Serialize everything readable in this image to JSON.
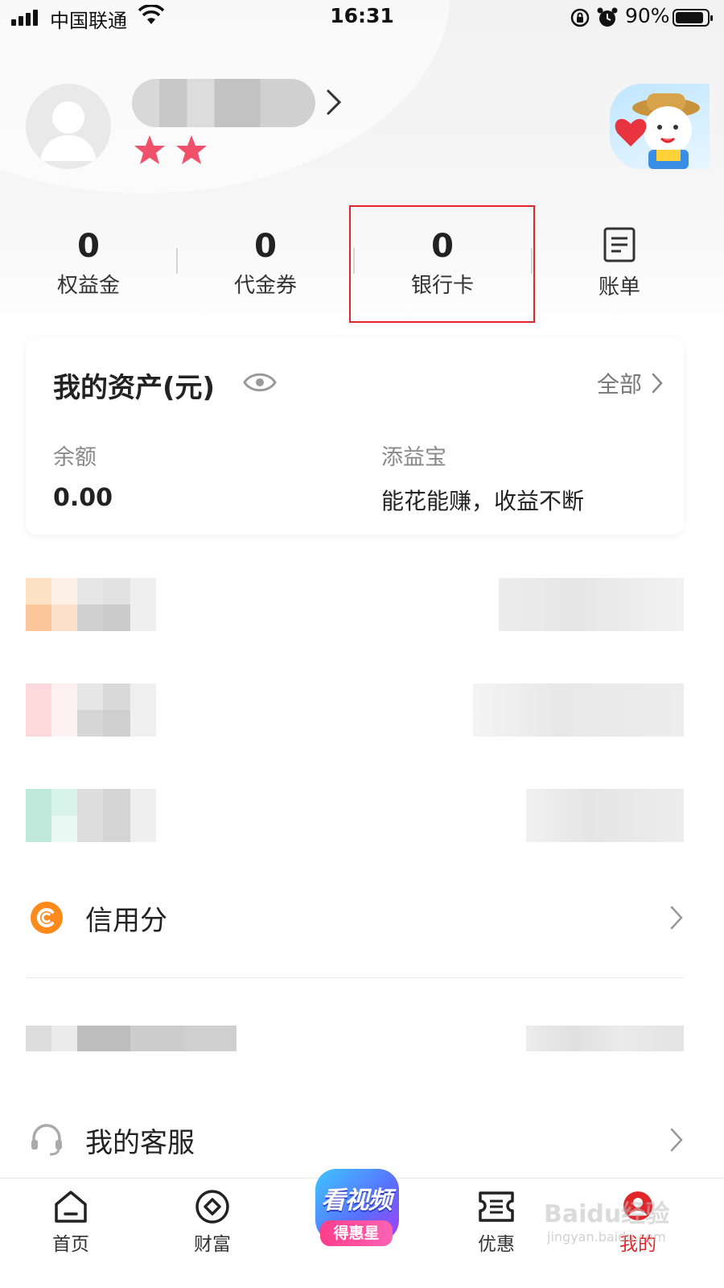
{
  "status_bar": {
    "carrier": "中国联通",
    "time": "16:31",
    "battery_percent": "90%",
    "battery_level": 0.9
  },
  "profile": {
    "star_count": 2
  },
  "stats": [
    {
      "value": "0",
      "label": "权益金"
    },
    {
      "value": "0",
      "label": "代金券"
    },
    {
      "value": "0",
      "label": "银行卡"
    },
    {
      "label": "账单"
    }
  ],
  "assets": {
    "title": "我的资产(元)",
    "all_label": "全部",
    "balance_label": "余额",
    "balance_value": "0.00",
    "product_label": "添益宝",
    "product_desc": "能花能赚，收益不断"
  },
  "list": {
    "credit_label": "信用分",
    "service_label": "我的客服"
  },
  "tabbar": {
    "home": "首页",
    "wealth": "财富",
    "promo_main": "看视频",
    "promo_sub": "得惠星",
    "offers": "优惠",
    "mine": "我的"
  },
  "watermark": {
    "text": "Baidu经验",
    "sub": "jingyan.baidu.com"
  },
  "colors": {
    "accent_red": "#e0262b",
    "star_pink": "#f0516a",
    "credit_orange": "#ff8a1c"
  }
}
